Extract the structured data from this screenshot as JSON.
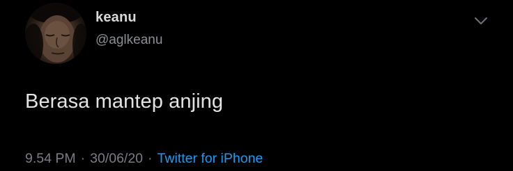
{
  "tweet": {
    "display_name": "keanu",
    "handle": "@aglkeanu",
    "text": "Berasa mantep anjing",
    "time": "9.54 PM",
    "date": "30/06/20",
    "separator": "·",
    "source": "Twitter for iPhone"
  },
  "icons": {
    "avatar": "profile-photo",
    "menu": "chevron-down-icon"
  },
  "colors": {
    "background": "#000000",
    "text": "#e3e3e3",
    "muted": "#7a7e82",
    "link": "#1d9bf0"
  }
}
